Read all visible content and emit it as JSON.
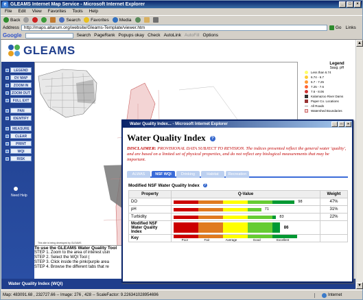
{
  "window": {
    "title": "GLEAMS Internet Map Service - Microsoft Internet Explorer",
    "controls": [
      "_",
      "□",
      "×"
    ]
  },
  "menubar": [
    "File",
    "Edit",
    "View",
    "Favorites",
    "Tools",
    "Help"
  ],
  "toolbar": {
    "back": "Back",
    "search": "Search",
    "favorites": "Favorites",
    "media": "Media"
  },
  "addressbar": {
    "label": "Address",
    "url": "http://maps.altarum.org/website/Gleams-Template/viewer.htm",
    "go": "Go",
    "links": "Links"
  },
  "googlebar": {
    "logo": "Google",
    "search": "Search",
    "pagerank": "PageRank",
    "popups": "Popups okay",
    "check": "Check",
    "autolink": "AutoLink",
    "autofill": "AutoFill",
    "options": "Options"
  },
  "app": {
    "logo_text": "GLEAMS",
    "sidebar": [
      {
        "label": "LEGEND"
      },
      {
        "label": "OV MAP"
      },
      {
        "label": "ZOOM IN"
      },
      {
        "label": "ZOOM OUT"
      },
      {
        "label": "FULL EXT"
      },
      {
        "label": "PAN"
      },
      {
        "label": "IDENTIFY"
      },
      {
        "label": "MEASURE"
      },
      {
        "label": "CLEAR"
      },
      {
        "label": "PRINT"
      },
      {
        "label": "WQI"
      },
      {
        "label": "RISK"
      }
    ],
    "need_help": "Need Help",
    "legend": {
      "title": "Legend",
      "subtitle": "Saug. pH",
      "items": [
        {
          "label": "Less than 6.74",
          "color": "#ffff66"
        },
        {
          "label": "6.74 - 6.7",
          "color": "#ffcc33"
        },
        {
          "label": "6.7 - 7.25",
          "color": "#ff9933"
        },
        {
          "label": "7.25 - 7.6",
          "color": "#ff6633"
        },
        {
          "label": "7.6 - 8.06",
          "color": "#cc3333"
        },
        {
          "label": "Kalamazoo River Dams",
          "color": "#333333"
        },
        {
          "label": "Paper Co. Locations",
          "color": "#993333"
        },
        {
          "label": "All Roads",
          "color": "#999999"
        },
        {
          "label": "Watershed Boundaries",
          "color": "#cc6666"
        }
      ]
    },
    "map_credit": "This site is being developed by GLEAMS",
    "instructions": {
      "title": "To use the GLEAMS Water Quality Tool",
      "steps": [
        "STEP 1. Zoom to the area of interest usin",
        "STEP 2. Select the WQI Tool (",
        "STEP 3. Click inside the pink/purple area",
        "STEP 4. Browse the different tabs that re"
      ]
    },
    "footer": "Water Quality Index (WQI)"
  },
  "popup": {
    "title": "Water Quality Index... - Microsoft Internet Explorer",
    "heading": "Water Quality Index",
    "disclaimer_label": "DISCLAIMER:",
    "disclaimer_text": "PROVISIONAL DATA SUBJECT TO REVISION. The indices presented reflect the general water 'quality', and are based on a limited set of physical properties, and do not reflect any biological measurements that may be important.",
    "tabs": [
      {
        "label": "ALWAS",
        "active": false
      },
      {
        "label": "NSF WQI",
        "active": true
      },
      {
        "label": "Drinking",
        "active": false
      },
      {
        "label": "Habitat",
        "active": false
      },
      {
        "label": "Recreation",
        "active": false
      }
    ],
    "subheading": "Modified NSF Water Quality Index",
    "table": {
      "headers": [
        "Property",
        "Q-Value",
        "Weight"
      ],
      "rows": [
        {
          "property": "DO",
          "qvalue": 98,
          "weight": "47%"
        },
        {
          "property": "pH",
          "qvalue": 71,
          "weight": "31%"
        },
        {
          "property": "Turbidity",
          "qvalue": 83,
          "weight": "22%"
        }
      ],
      "modified": {
        "label": "Modified NSF Water Quality Index",
        "value": 86
      },
      "key": {
        "label": "Key",
        "levels": [
          "Poor",
          "Fair",
          "Average",
          "Good",
          "Excellent"
        ],
        "colors": [
          "#cc0000",
          "#e07a1f",
          "#ffff00",
          "#66cc33",
          "#009933"
        ]
      }
    }
  },
  "statusbar": {
    "text": "Map: 483091.68 , 232727.66 -- Image: 276 , 428 -- ScaleFactor: 9.226341028954696",
    "zone": "Internet"
  }
}
